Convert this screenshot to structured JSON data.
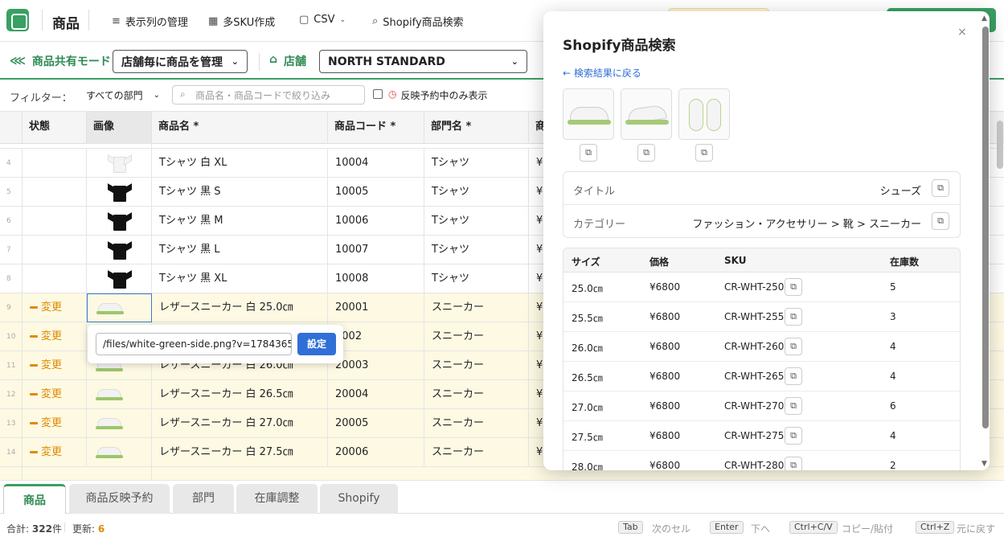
{
  "topbar": {
    "title": "商品",
    "menu": [
      {
        "icon": "list-icon",
        "label": "表示列の管理"
      },
      {
        "icon": "grid-icon",
        "label": "多SKU作成"
      },
      {
        "icon": "file-icon",
        "label": "CSV"
      },
      {
        "icon": "search-icon",
        "label": "Shopify商品検索"
      }
    ],
    "colors": {
      "brand": "#3aa063",
      "notice": "#fdf3d8"
    }
  },
  "modebar": {
    "mode_label": "商品共有モード",
    "mode_value": "店舗毎に商品を管理",
    "store_label": "店舗",
    "store_value": "NORTH STANDARD"
  },
  "filterbar": {
    "label": "フィルター：",
    "dept_value": "すべての部門",
    "search_placeholder": "商品名・商品コードで絞り込み",
    "pending_label": "反映予約中のみ表示"
  },
  "table": {
    "columns": [
      "状態",
      "画像",
      "商品名 *",
      "商品コード *",
      "部門名 *",
      "商"
    ],
    "rows": [
      {
        "num": "4",
        "status": "",
        "image": "white-tee",
        "name": "Tシャツ 白 XL",
        "code": "10004",
        "dept": "Tシャツ",
        "price": "¥",
        "changed": false
      },
      {
        "num": "5",
        "status": "",
        "image": "black-tee",
        "name": "Tシャツ 黒 S",
        "code": "10005",
        "dept": "Tシャツ",
        "price": "¥",
        "changed": false
      },
      {
        "num": "6",
        "status": "",
        "image": "black-tee",
        "name": "Tシャツ 黒 M",
        "code": "10006",
        "dept": "Tシャツ",
        "price": "¥",
        "changed": false
      },
      {
        "num": "7",
        "status": "",
        "image": "black-tee",
        "name": "Tシャツ 黒 L",
        "code": "10007",
        "dept": "Tシャツ",
        "price": "¥",
        "changed": false
      },
      {
        "num": "8",
        "status": "",
        "image": "black-tee",
        "name": "Tシャツ 黒 XL",
        "code": "10008",
        "dept": "Tシャツ",
        "price": "¥",
        "changed": false
      },
      {
        "num": "9",
        "status": "変更",
        "image": "shoe",
        "name": "レザースニーカー 白 25.0㎝",
        "code": "20001",
        "dept": "スニーカー",
        "price": "¥",
        "changed": true
      },
      {
        "num": "10",
        "status": "変更",
        "image": "shoe",
        "name": "",
        "code": "0002",
        "dept": "スニーカー",
        "price": "¥",
        "changed": true
      },
      {
        "num": "11",
        "status": "変更",
        "image": "shoe",
        "name": "レザースニーカー 白 26.0㎝",
        "code": "20003",
        "dept": "スニーカー",
        "price": "¥",
        "changed": true
      },
      {
        "num": "12",
        "status": "変更",
        "image": "shoe",
        "name": "レザースニーカー 白 26.5㎝",
        "code": "20004",
        "dept": "スニーカー",
        "price": "¥",
        "changed": true
      },
      {
        "num": "13",
        "status": "変更",
        "image": "shoe",
        "name": "レザースニーカー 白 27.0㎝",
        "code": "20005",
        "dept": "スニーカー",
        "price": "¥",
        "changed": true
      },
      {
        "num": "14",
        "status": "変更",
        "image": "shoe",
        "name": "レザースニーカー 白 27.5㎝",
        "code": "20006",
        "dept": "スニーカー",
        "price": "¥",
        "changed": true
      }
    ]
  },
  "url_popup": {
    "value": "/files/white-green-side.png?v=1784365531",
    "button": "設定"
  },
  "tabs": [
    {
      "label": "商品",
      "active": true
    },
    {
      "label": "商品反映予約",
      "active": false
    },
    {
      "label": "部門",
      "active": false
    },
    {
      "label": "在庫調整",
      "active": false
    },
    {
      "label": "Shopify",
      "active": false
    }
  ],
  "statusbar": {
    "total_label": "合計:",
    "total_value": "322",
    "total_unit": "件",
    "updated_label": "更新:",
    "updated_value": "6",
    "shortcuts": [
      {
        "key": "Tab",
        "desc": "次のセル"
      },
      {
        "key": "Enter",
        "desc": "下へ"
      },
      {
        "key": "Ctrl+C/V",
        "desc": "コピー/貼付"
      },
      {
        "key": "Ctrl+Z",
        "desc": "元に戻す"
      }
    ]
  },
  "shopify_panel": {
    "title": "Shopify商品検索",
    "close": "×",
    "back": "← 検索結果に戻る",
    "info": [
      {
        "key": "タイトル",
        "value": "シューズ"
      },
      {
        "key": "カテゴリー",
        "value": "ファッション・アクセサリー > 靴 > スニーカー"
      }
    ],
    "variant_columns": [
      "サイズ",
      "価格",
      "SKU",
      "在庫数"
    ],
    "variants": [
      {
        "size": "25.0㎝",
        "price": "¥6800",
        "sku": "CR-WHT-250",
        "stock": "5"
      },
      {
        "size": "25.5㎝",
        "price": "¥6800",
        "sku": "CR-WHT-255",
        "stock": "3"
      },
      {
        "size": "26.0㎝",
        "price": "¥6800",
        "sku": "CR-WHT-260",
        "stock": "4"
      },
      {
        "size": "26.5㎝",
        "price": "¥6800",
        "sku": "CR-WHT-265",
        "stock": "4"
      },
      {
        "size": "27.0㎝",
        "price": "¥6800",
        "sku": "CR-WHT-270",
        "stock": "6"
      },
      {
        "size": "27.5㎝",
        "price": "¥6800",
        "sku": "CR-WHT-275",
        "stock": "4"
      },
      {
        "size": "28.0㎝",
        "price": "¥6800",
        "sku": "CR-WHT-280",
        "stock": "2"
      }
    ]
  }
}
